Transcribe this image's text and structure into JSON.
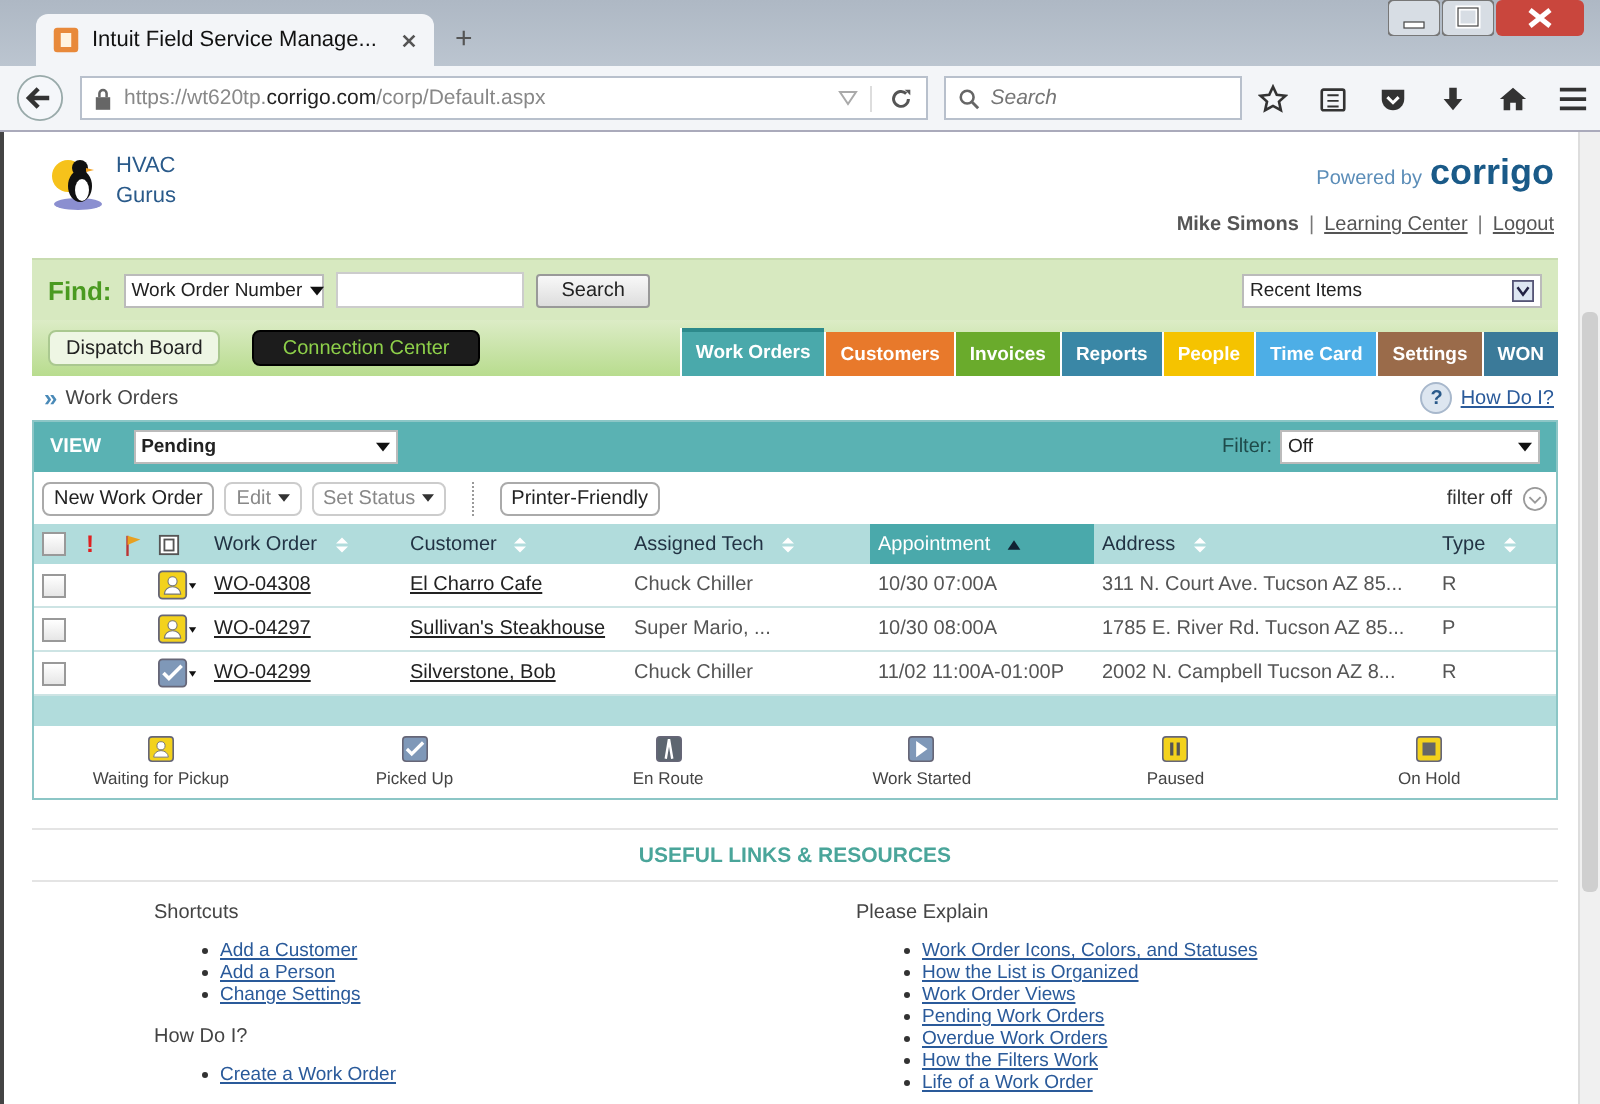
{
  "browser": {
    "tab_title": "Intuit Field Service Manage...",
    "new_tab": "+",
    "url": "https://wt620tp.**corrigo.com**/corp/Default.aspx",
    "search_placeholder": "Search"
  },
  "header": {
    "company": "HVAC Gurus",
    "powered_by": "Powered by",
    "brand": "corrigo",
    "user": "Mike Simons",
    "separator": "|",
    "links": [
      "Learning Center",
      "Logout"
    ]
  },
  "find": {
    "label": "Find:",
    "field_type": "Work Order Number",
    "button": "Search",
    "recent": "Recent Items"
  },
  "quick_buttons": [
    {
      "label": "Dispatch Board",
      "kind": "light"
    },
    {
      "label": "Connection Center",
      "kind": "dark"
    }
  ],
  "nav_tabs": [
    {
      "label": "Work Orders",
      "color": "#4aa9ab",
      "selected": true
    },
    {
      "label": "Customers",
      "color": "#e8792b",
      "selected": false
    },
    {
      "label": "Invoices",
      "color": "#6aab2c",
      "selected": false
    },
    {
      "label": "Reports",
      "color": "#3a87a6",
      "selected": false
    },
    {
      "label": "People",
      "color": "#f5c300",
      "selected": false
    },
    {
      "label": "Time Card",
      "color": "#4daee6",
      "selected": false
    },
    {
      "label": "Settings",
      "color": "#9a6b4a",
      "selected": false
    },
    {
      "label": "WON",
      "color": "#3b7a99",
      "selected": false
    }
  ],
  "breadcrumb_mark": "»",
  "breadcrumb": "Work Orders",
  "help": {
    "icon": "?",
    "label": "How Do I?"
  },
  "view": {
    "label": "VIEW",
    "value": "Pending",
    "filter_label": "Filter:",
    "filter_value": "Off"
  },
  "toolbar": [
    {
      "label": "New Work Order",
      "kind": "button",
      "disabled": false
    },
    {
      "label": "Edit",
      "kind": "dropdown",
      "disabled": true
    },
    {
      "label": "Set Status",
      "kind": "dropdown",
      "disabled": true
    },
    {
      "label": "Printer-Friendly",
      "kind": "button",
      "disabled": false
    }
  ],
  "filter_toggle": "filter off",
  "table": {
    "select_all_checked": false,
    "priority_mark": "!",
    "columns": [
      {
        "label": "Work Order",
        "sorted": false
      },
      {
        "label": "Customer",
        "sorted": false
      },
      {
        "label": "Assigned Tech",
        "sorted": false
      },
      {
        "label": "Appointment",
        "sorted": true
      },
      {
        "label": "Address",
        "sorted": false
      },
      {
        "label": "Type",
        "sorted": false
      }
    ],
    "rows": [
      {
        "checked": false,
        "kind": "waiting",
        "work_order": "WO-04308",
        "customer": "El Charro Cafe",
        "tech": "Chuck Chiller",
        "appointment": "10/30 07:00A",
        "address": "311 N. Court Ave. Tucson AZ 85...",
        "type": "R"
      },
      {
        "checked": false,
        "kind": "waiting",
        "work_order": "WO-04297",
        "customer": "Sullivan's Steakhouse",
        "tech": "Super Mario, ...",
        "appointment": "10/30 08:00A",
        "address": "1785 E. River Rd. Tucson AZ 85...",
        "type": "P"
      },
      {
        "checked": false,
        "kind": "picked",
        "work_order": "WO-04299",
        "customer": "Silverstone, Bob",
        "tech": "Chuck Chiller",
        "appointment": "11/02 11:00A-01:00P",
        "address": "2002 N. Campbell Tucson AZ 8...",
        "type": "R"
      }
    ]
  },
  "legend": [
    {
      "label": "Waiting for Pickup",
      "kind": "waiting"
    },
    {
      "label": "Picked Up",
      "kind": "picked"
    },
    {
      "label": "En Route",
      "kind": "enroute"
    },
    {
      "label": "Work Started",
      "kind": "started"
    },
    {
      "label": "Paused",
      "kind": "paused"
    },
    {
      "label": "On Hold",
      "kind": "hold"
    }
  ],
  "resources": {
    "title": "USEFUL LINKS & RESOURCES",
    "columns": [
      [
        {
          "heading": "Shortcuts",
          "links": [
            "Add a Customer",
            "Add a Person",
            "Change Settings"
          ]
        },
        {
          "heading": "How Do I?",
          "links": [
            "Create a Work Order"
          ]
        }
      ],
      [
        {
          "heading": "Please Explain",
          "links": [
            "Work Order Icons, Colors, and Statuses",
            "How the List is Organized",
            "Work Order Views",
            "Pending Work Orders",
            "Overdue Work Orders",
            "How the Filters Work",
            "Life of a Work Order"
          ]
        }
      ]
    ]
  }
}
